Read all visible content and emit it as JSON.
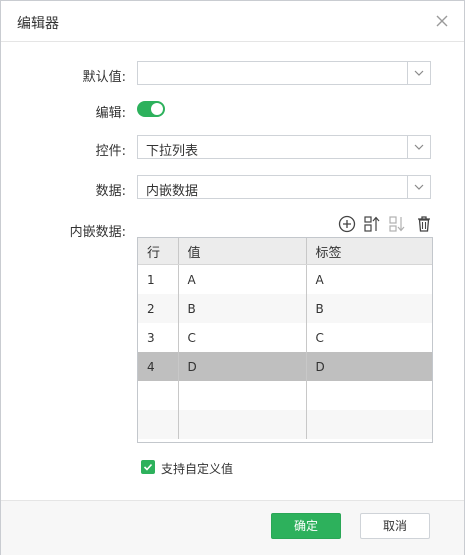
{
  "dialog": {
    "title": "编辑器"
  },
  "form": {
    "default_value_label": "默认值:",
    "default_value": "",
    "editable_label": "编辑:",
    "editable_on": true,
    "control_label": "控件:",
    "control_value": "下拉列表",
    "data_label": "数据:",
    "data_value": "内嵌数据",
    "embedded_label": "内嵌数据:"
  },
  "toolbar": {
    "icons": [
      "add-circle-icon",
      "sort-ascending-icon",
      "sort-descending-icon",
      "delete-icon"
    ]
  },
  "table": {
    "columns": [
      "行",
      "值",
      "标签"
    ],
    "rows": [
      {
        "row": "1",
        "value": "A",
        "label": "A"
      },
      {
        "row": "2",
        "value": "B",
        "label": "B"
      },
      {
        "row": "3",
        "value": "C",
        "label": "C"
      },
      {
        "row": "4",
        "value": "D",
        "label": "D"
      }
    ],
    "selected_row": 4
  },
  "custom_value": {
    "label": "支持自定义值",
    "checked": true
  },
  "footer": {
    "ok": "确定",
    "cancel": "取消"
  },
  "colors": {
    "accent": "#2db15c",
    "selected_row": "#bfbfbf",
    "header": "#ececec"
  }
}
